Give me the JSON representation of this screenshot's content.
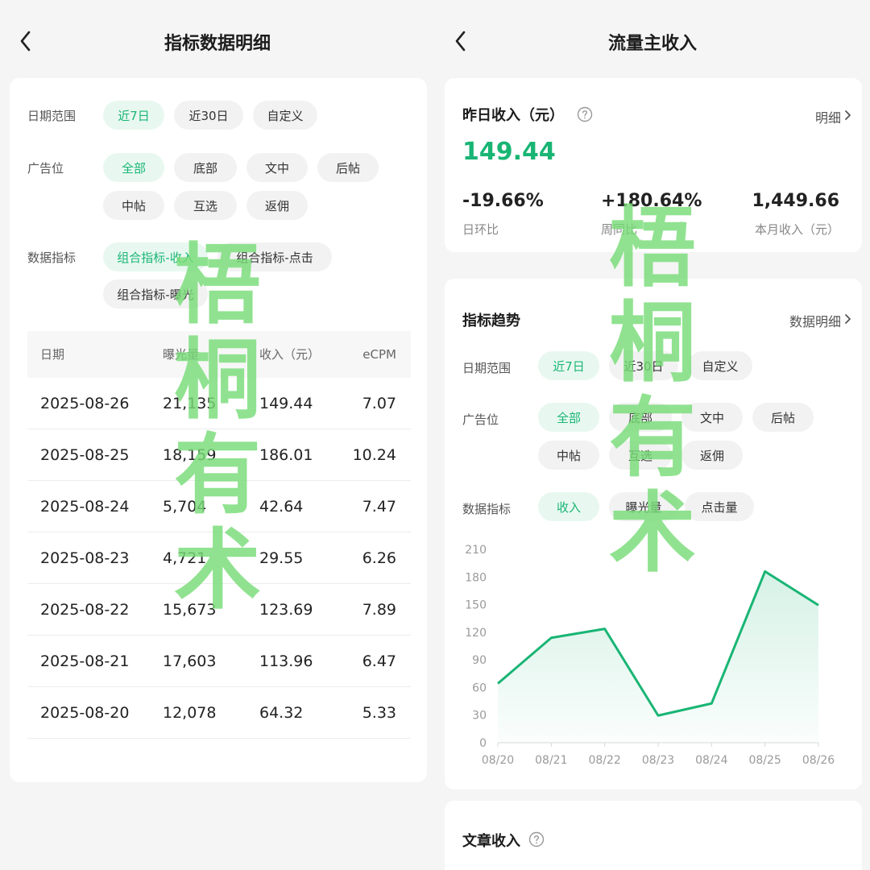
{
  "left": {
    "title": "指标数据明细",
    "date_range": {
      "label": "日期范围",
      "options": [
        "近7日",
        "近30日",
        "自定义"
      ],
      "selected": "近7日"
    },
    "ad_slot": {
      "label": "广告位",
      "options": [
        "全部",
        "底部",
        "文中",
        "后帖",
        "中帖",
        "互选",
        "返佣"
      ],
      "selected": "全部"
    },
    "metric": {
      "label": "数据指标",
      "options": [
        "组合指标-收入",
        "组合指标-点击",
        "组合指标-曝光"
      ],
      "selected": "组合指标-收入"
    },
    "table": {
      "headers": [
        "日期",
        "曝光量",
        "收入（元）",
        "eCPM"
      ],
      "rows": [
        [
          "2025-08-26",
          "21,135",
          "149.44",
          "7.07"
        ],
        [
          "2025-08-25",
          "18,159",
          "186.01",
          "10.24"
        ],
        [
          "2025-08-24",
          "5,704",
          "42.64",
          "7.47"
        ],
        [
          "2025-08-23",
          "4,721",
          "29.55",
          "6.26"
        ],
        [
          "2025-08-22",
          "15,673",
          "123.69",
          "7.89"
        ],
        [
          "2025-08-21",
          "17,603",
          "113.96",
          "6.47"
        ],
        [
          "2025-08-20",
          "12,078",
          "64.32",
          "5.33"
        ]
      ]
    }
  },
  "right": {
    "title": "流量主收入",
    "income": {
      "title": "昨日收入（元）",
      "detail_link": "明细",
      "value": "149.44",
      "stats": [
        {
          "value": "-19.66%",
          "label": "日环比"
        },
        {
          "value": "+180.64%",
          "label": "周同比"
        },
        {
          "value": "1,449.66",
          "label": "本月收入（元）"
        }
      ]
    },
    "trend": {
      "title": "指标趋势",
      "detail_link": "数据明细",
      "date_range": {
        "label": "日期范围",
        "options": [
          "近7日",
          "近30日",
          "自定义"
        ],
        "selected": "近7日"
      },
      "ad_slot": {
        "label": "广告位",
        "options": [
          "全部",
          "底部",
          "文中",
          "后帖",
          "中帖",
          "互选",
          "返佣"
        ],
        "selected": "全部"
      },
      "metric": {
        "label": "数据指标",
        "options": [
          "收入",
          "曝光量",
          "点击量"
        ],
        "selected": "收入"
      }
    },
    "article": {
      "title": "文章收入"
    }
  },
  "watermark": {
    "chars": [
      "梧",
      "桐",
      "有",
      "术"
    ]
  },
  "colors": {
    "accent": "#19b574",
    "chip_active_bg": "#e8f8f0",
    "chip_bg": "#f2f2f2",
    "page_bg": "#f4f5f4"
  },
  "icons": {
    "back": "chevron-left-icon",
    "help": "question-circle-icon",
    "more": "chevron-right-icon"
  },
  "chart_data": {
    "type": "area",
    "categories": [
      "08/20",
      "08/21",
      "08/22",
      "08/23",
      "08/24",
      "08/25",
      "08/26"
    ],
    "values": [
      64.32,
      113.96,
      123.69,
      29.55,
      42.64,
      186.01,
      149.44
    ],
    "y_ticks": [
      0,
      30,
      60,
      90,
      120,
      150,
      180,
      210
    ],
    "ylim": [
      0,
      210
    ],
    "grid": false,
    "color": "#19b574"
  }
}
